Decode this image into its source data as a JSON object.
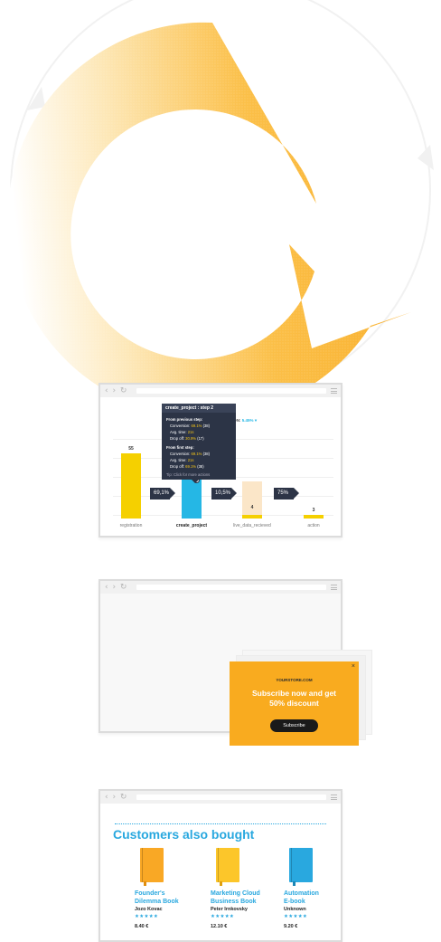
{
  "colors": {
    "ring_orange": "#fab12b",
    "ring_light": "#fde3a9",
    "funnel_yellow": "#f5d000",
    "funnel_blue": "#25b7e5",
    "funnel_peach": "#fbe6c8",
    "dark_navy": "#2c3446",
    "popup_orange": "#f9ab1f",
    "accent_blue": "#29a8df"
  },
  "funnel": {
    "overall_label": "ESION:",
    "overall_value": "5.45%",
    "bars": [
      {
        "name": "registration",
        "value": "55",
        "level": 1.0
      },
      {
        "name": "create_project",
        "value": "",
        "level": 0.8
      },
      {
        "name": "live_data_recieved",
        "value": "4",
        "level": 0.06
      },
      {
        "name": "action",
        "value": "3",
        "level": 0.045
      }
    ],
    "conversions": [
      "69,1%",
      "10,5%",
      "75%"
    ],
    "tooltip": {
      "title": "create_project : step 2",
      "prev_heading": "From previous step:",
      "prev_conversion_label": "Conversion:",
      "prev_conversion_value": "69.1%",
      "prev_conversion_count": "(38)",
      "prev_time_label": "Avg. time:",
      "prev_time_value": "21s",
      "prev_dropoff_label": "Drop off:",
      "prev_dropoff_value": "30.9%",
      "prev_dropoff_count": "(17)",
      "first_heading": "From first step:",
      "first_conversion_label": "Conversion:",
      "first_conversion_value": "69.1%",
      "first_conversion_count": "(38)",
      "first_time_label": "Avg. time:",
      "first_time_value": "21s",
      "first_dropoff_label": "Drop off:",
      "first_dropoff_value": "69.1%",
      "first_dropoff_count": "(38)",
      "tip": "Tip: Click for more actions"
    }
  },
  "popup": {
    "store": "YOURSTORE.COM",
    "headline_1": "Subscribe now and get",
    "headline_2": "50% discount",
    "button": "Subscribe",
    "close": "×"
  },
  "recommendations": {
    "title": "Customers also bought",
    "items": [
      {
        "title_1": "Founder's",
        "title_2": "Dilemma Book",
        "author": "Jozo Kovac",
        "rating": "★★★★★",
        "price": "8.40 €",
        "color": "#f9a825"
      },
      {
        "title_1": "Marketing Cloud",
        "title_2": "Business Book",
        "author": "Peter Irnkovsky",
        "rating": "★★★★★",
        "price": "12.10 €",
        "color": "#fcc62a"
      },
      {
        "title_1": "Automation",
        "title_2": "E-book",
        "author": "Unknown",
        "rating": "★★★★★",
        "price": "9.20 €",
        "color": "#29a8df"
      }
    ]
  }
}
